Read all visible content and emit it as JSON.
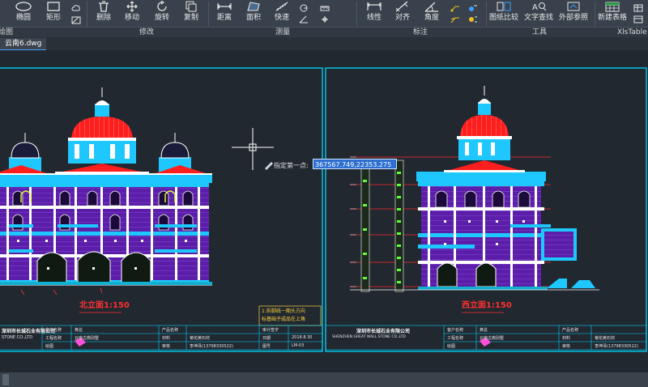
{
  "ribbon": {
    "tools": [
      {
        "label": "椭圆",
        "icon": "ellipse-icon"
      },
      {
        "label": "矩形",
        "icon": "rectangle-icon"
      },
      {
        "label": "删除",
        "icon": "delete-icon"
      },
      {
        "label": "移动",
        "icon": "move-icon"
      },
      {
        "label": "旋转",
        "icon": "rotate-icon"
      },
      {
        "label": "复制",
        "icon": "copy-icon"
      },
      {
        "label": "距离",
        "icon": "distance-icon"
      },
      {
        "label": "面积",
        "icon": "area-icon"
      },
      {
        "label": "快速",
        "icon": "quick-measure-icon"
      },
      {
        "label": "线性",
        "icon": "linear-dimension-icon"
      },
      {
        "label": "对齐",
        "icon": "aligned-dimension-icon"
      },
      {
        "label": "角度",
        "icon": "angle-dimension-icon"
      },
      {
        "label": "图纸比较",
        "icon": "drawing-compare-icon"
      },
      {
        "label": "文字查找",
        "icon": "text-find-icon"
      },
      {
        "label": "外部参照",
        "icon": "xref-icon"
      },
      {
        "label": "新建表格",
        "icon": "new-table-icon"
      }
    ],
    "groups": [
      "绘图",
      "修改",
      "测量",
      "标注",
      "工具",
      "XlsTable"
    ]
  },
  "file_tab": {
    "label": "云南6.dwg"
  },
  "command": {
    "prompt": "指定第一点:",
    "coordinate": "367567.749,22353.275"
  },
  "drawings": {
    "north_title": "北立面1:150",
    "west_title": "西立面1:150",
    "annotation_line1": "1:拆脚线一期头方向",
    "annotation_line2": "标基础子成品在上角"
  },
  "title_block": {
    "company_cn": "深圳市长城石业有限公司",
    "company_en": "SHENZHEN GREAT WALL STONE CO.,LTD",
    "company_en_left": "STONE CO.,LTD",
    "client_label": "客户名称",
    "client_value": "黄总",
    "project_label": "工程名称",
    "project_value": "云南古典别墅",
    "drawn_label": "绘图",
    "product_label": "产品名称",
    "material_label": "材料",
    "material_value": "菊花黄石材",
    "review_label": "审核",
    "reviewer": "李坤泽(13798330522)",
    "approve_label": "审计签字",
    "date_label": "日期",
    "date_value": "2018.8.30",
    "drawing_no_label": "图号",
    "drawing_no": "LM-03"
  },
  "colors": {
    "background": "#212830",
    "frame": "#00d8ff",
    "building": "#7a2fd0",
    "dome": "#ff1e1e",
    "trim": "#ffffff",
    "annotation": "#ffd23a",
    "level_line": "#ff2a2a",
    "highlight": "#2d6fd1"
  }
}
